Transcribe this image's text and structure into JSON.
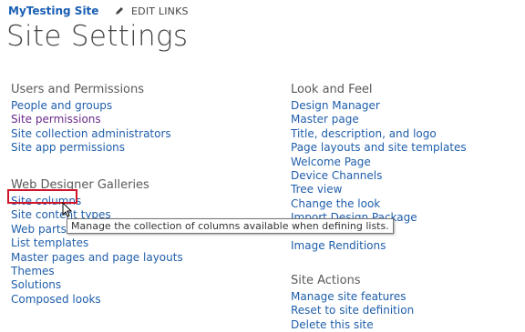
{
  "header": {
    "site_name": "MyTesting Site",
    "edit_links_label": "EDIT LINKS",
    "page_title": "Site Settings"
  },
  "sections": {
    "users": {
      "heading": "Users and Permissions",
      "items": [
        "People and groups",
        "Site permissions",
        "Site collection administrators",
        "Site app permissions"
      ]
    },
    "galleries": {
      "heading": "Web Designer Galleries",
      "items": [
        "Site columns",
        "Site content types",
        "Web parts",
        "List templates",
        "Master pages and page layouts",
        "Themes",
        "Solutions",
        "Composed looks"
      ]
    },
    "look": {
      "heading": "Look and Feel",
      "items": [
        "Design Manager",
        "Master page",
        "Title, description, and logo",
        "Page layouts and site templates",
        "Welcome Page",
        "Device Channels",
        "Tree view",
        "Change the look",
        "Import Design Package",
        "",
        "Image Renditions"
      ]
    },
    "actions": {
      "heading": "Site Actions",
      "items": [
        "Manage site features",
        "Reset to site definition",
        "Delete this site"
      ]
    }
  },
  "tooltip": "Manage the collection of columns available when defining lists.",
  "colors": {
    "link": "#1f5eaa",
    "visited_link": "#6a2a8a",
    "highlight": "#d0142a"
  },
  "icons": {
    "edit": "pencil-icon",
    "cursor": "mouse-pointer-icon"
  }
}
